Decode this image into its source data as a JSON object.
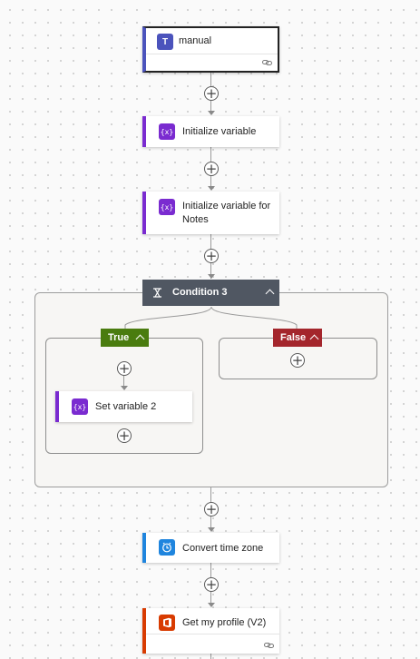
{
  "trigger": {
    "label": "manual",
    "icon": "teams-icon",
    "accent": "#4b53bc"
  },
  "actions": {
    "init_var": {
      "label": "Initialize variable",
      "icon": "variable-icon",
      "accent": "#7a2bd0"
    },
    "init_var_notes": {
      "label": "Initialize variable for Notes",
      "icon": "variable-icon",
      "accent": "#7a2bd0"
    },
    "set_var": {
      "label": "Set variable 2",
      "icon": "variable-icon",
      "accent": "#7a2bd0"
    },
    "convert_time": {
      "label": "Convert time zone",
      "icon": "clock-icon",
      "accent": "#1f85de"
    },
    "get_profile": {
      "label": "Get my profile (V2)",
      "icon": "office-icon",
      "accent": "#d83b01"
    }
  },
  "condition": {
    "title": "Condition 3",
    "header_color": "#505762",
    "true_label": "True",
    "true_color": "#4a7c0f",
    "false_label": "False",
    "false_color": "#a4262c"
  },
  "variable_glyph": "{x}"
}
